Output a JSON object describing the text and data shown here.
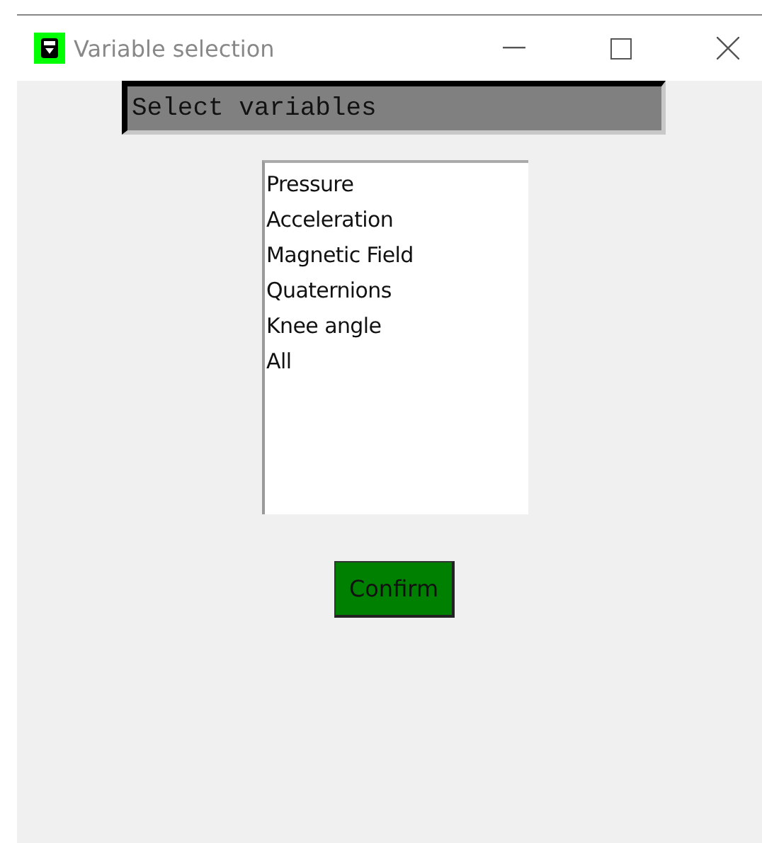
{
  "window": {
    "title": "Variable selection"
  },
  "header": {
    "text": "Select variables"
  },
  "listbox": {
    "items": [
      "Pressure",
      "Acceleration",
      "Magnetic Field",
      "Quaternions",
      "Knee angle",
      "All"
    ]
  },
  "buttons": [
    "Confirm"
  ]
}
